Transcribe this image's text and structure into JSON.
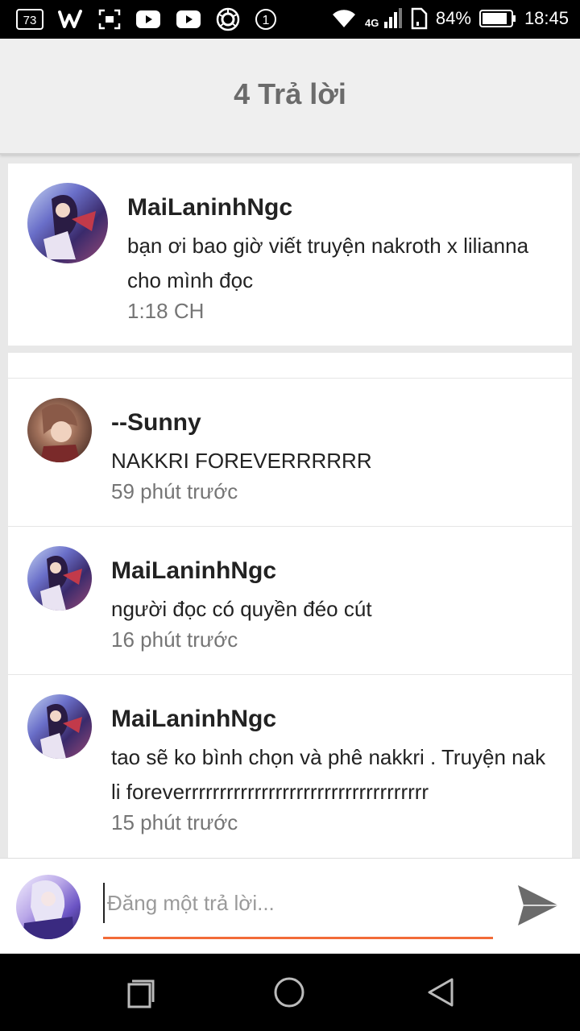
{
  "status_bar": {
    "notification_badge": "73",
    "network_type": "4G",
    "battery": "84%",
    "time": "18:45",
    "circled_count": "1"
  },
  "header": {
    "title": "4 Trả lời"
  },
  "original_comment": {
    "author": "MaiLaninhNgc",
    "text": "bạn ơi bao giờ viết truyện nakroth x lilianna cho mình đọc",
    "time": "1:18 CH"
  },
  "replies": [
    {
      "author": "--Sunny",
      "text": "NAKKRI FOREVERRRRRR",
      "time": "59 phút trước"
    },
    {
      "author": "MaiLaninhNgc",
      "text": "người đọc có quyền đéo cút",
      "time": "16 phút trước"
    },
    {
      "author": "MaiLaninhNgc",
      "text": "tao sẽ ko bình chọn và phê nakkri . Truyện nakli foreverrrrrrrrrrrrrrrrrrrrrrrrrrrrrrrrrrr",
      "time": "15 phút trước"
    }
  ],
  "composer": {
    "placeholder": "Đăng một trả lời...",
    "underline_color": "#f26b38"
  },
  "icons": {
    "send": "send-icon",
    "recents": "recents-icon",
    "home": "home-icon",
    "back": "back-icon"
  }
}
